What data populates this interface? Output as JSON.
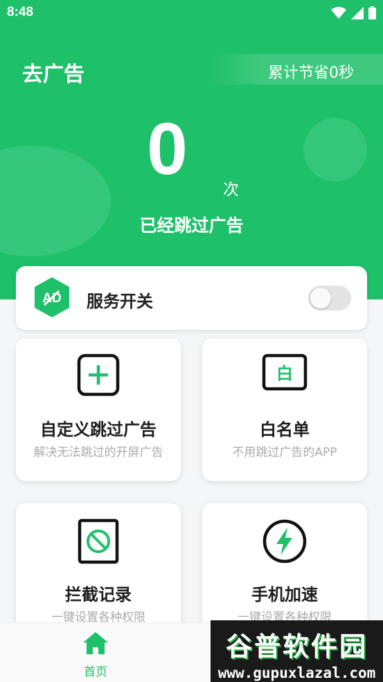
{
  "status_bar": {
    "time": "8:48",
    "icons": [
      "wifi-icon",
      "signal-icon",
      "battery-icon"
    ]
  },
  "header": {
    "title": "去广告",
    "savings": "累计节省0秒",
    "skip_count": "0",
    "count_unit": "次",
    "caption": "已经跳过广告"
  },
  "service": {
    "badge_text": "AD",
    "label": "服务开关",
    "enabled": false
  },
  "features": [
    {
      "title": "自定义跳过广告",
      "subtitle": "解决无法跳过的开屏广告",
      "icon": "plus-square-icon"
    },
    {
      "title": "白名单",
      "subtitle": "不用跳过广告的APP",
      "icon": "whitelist-icon"
    },
    {
      "title": "拦截记录",
      "subtitle": "一键设置各种权限",
      "icon": "block-icon"
    },
    {
      "title": "手机加速",
      "subtitle": "一键设置各种权限",
      "icon": "lightning-icon"
    }
  ],
  "whitelist_icon_char": "白",
  "bottom_nav": {
    "home_label": "首页"
  },
  "watermark": {
    "title": "谷普软件园",
    "url": "www.gupuxlazal.com"
  },
  "colors": {
    "primary": "#1ec06a",
    "background": "#f5f6f7"
  }
}
